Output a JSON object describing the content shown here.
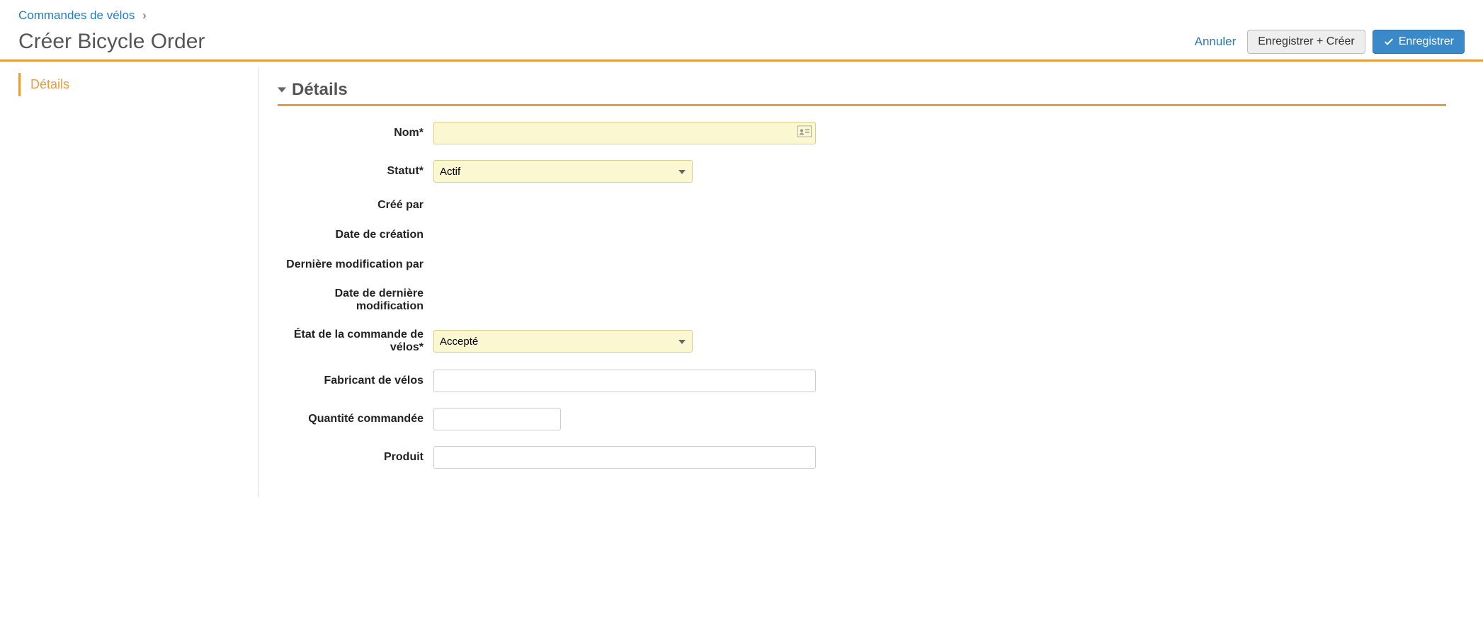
{
  "breadcrumb": {
    "parent": "Commandes de vélos"
  },
  "header": {
    "title": "Créer Bicycle Order",
    "cancel": "Annuler",
    "save_create": "Enregistrer + Créer",
    "save": "Enregistrer"
  },
  "sidebar": {
    "tab_details": "Détails"
  },
  "section": {
    "title": "Détails"
  },
  "form": {
    "name": {
      "label": "Nom*",
      "value": ""
    },
    "status": {
      "label": "Statut*",
      "value": "Actif"
    },
    "created_by": {
      "label": "Créé par",
      "value": ""
    },
    "created_date": {
      "label": "Date de création",
      "value": ""
    },
    "modified_by": {
      "label": "Dernière modification par",
      "value": ""
    },
    "modified_date": {
      "label": "Date de dernière modification",
      "value": ""
    },
    "order_state": {
      "label": "État de la commande de vélos*",
      "value": "Accepté"
    },
    "manufacturer": {
      "label": "Fabricant de vélos",
      "value": ""
    },
    "quantity": {
      "label": "Quantité commandée",
      "value": ""
    },
    "product": {
      "label": "Produit",
      "value": ""
    }
  }
}
